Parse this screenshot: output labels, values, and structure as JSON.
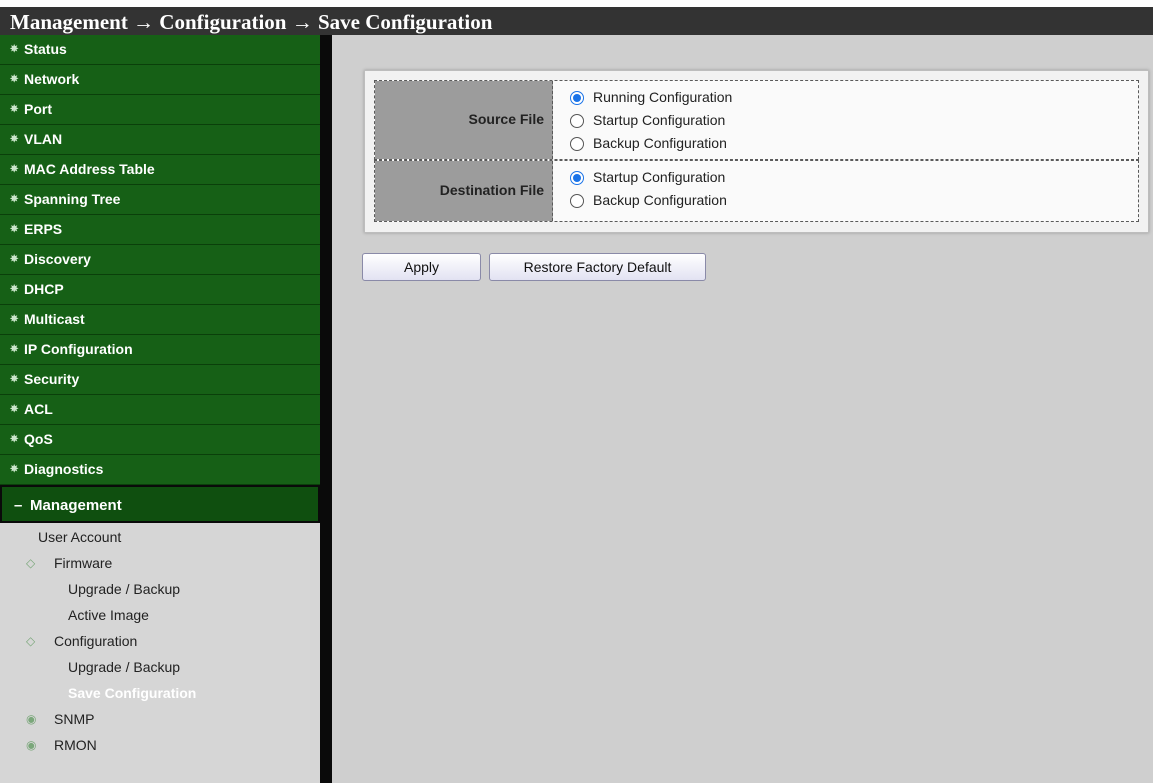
{
  "breadcrumb": "Management → Configuration → Save Configuration",
  "sidebar": {
    "items": [
      {
        "label": "Status"
      },
      {
        "label": "Network"
      },
      {
        "label": "Port"
      },
      {
        "label": "VLAN"
      },
      {
        "label": "MAC Address Table"
      },
      {
        "label": "Spanning Tree"
      },
      {
        "label": "ERPS"
      },
      {
        "label": "Discovery"
      },
      {
        "label": "DHCP"
      },
      {
        "label": "Multicast"
      },
      {
        "label": "IP Configuration"
      },
      {
        "label": "Security"
      },
      {
        "label": "ACL"
      },
      {
        "label": "QoS"
      },
      {
        "label": "Diagnostics"
      }
    ],
    "open_section": "Management",
    "submenu": [
      {
        "label": "User Account"
      },
      {
        "label": "Firmware"
      },
      {
        "label": "Upgrade / Backup"
      },
      {
        "label": "Active Image"
      },
      {
        "label": "Configuration"
      },
      {
        "label": "Upgrade / Backup"
      },
      {
        "label": "Save Configuration"
      },
      {
        "label": "SNMP"
      },
      {
        "label": "RMON"
      }
    ]
  },
  "form": {
    "source": {
      "label": "Source File",
      "options": [
        "Running Configuration",
        "Startup Configuration",
        "Backup Configuration"
      ],
      "selected": "Running Configuration"
    },
    "destination": {
      "label": "Destination File",
      "options": [
        "Startup Configuration",
        "Backup Configuration"
      ],
      "selected": "Startup Configuration"
    }
  },
  "buttons": {
    "apply": "Apply",
    "restore": "Restore Factory Default"
  }
}
